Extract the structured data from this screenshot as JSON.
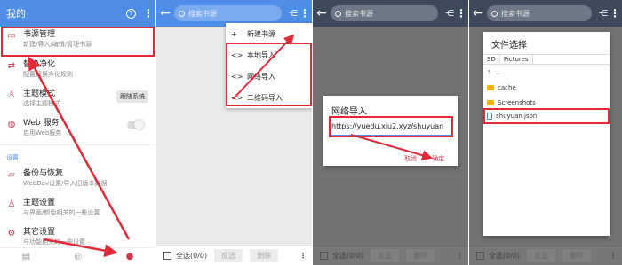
{
  "panel1": {
    "title": "我的",
    "items": [
      {
        "icon": "book-icon",
        "title": "书源管理",
        "subtitle": "新建/导入/编辑/管理书源"
      },
      {
        "icon": "replace-icon",
        "title": "替换净化",
        "subtitle": "配置替换净化规则"
      },
      {
        "icon": "shirt-icon",
        "title": "主题模式",
        "subtitle": "选择主题模式",
        "badge": "跟随系统"
      },
      {
        "icon": "globe-icon",
        "title": "Web 服务",
        "subtitle": "启用Web服务"
      }
    ],
    "section_label": "设置",
    "settings": [
      {
        "icon": "folder-icon",
        "title": "备份与恢复",
        "subtitle": "WebDav设置/导入旧版本数据"
      },
      {
        "icon": "shirt-icon",
        "title": "主题设置",
        "subtitle": "与界面/颜色相关的一些设置"
      },
      {
        "icon": "gear-icon",
        "title": "其它设置",
        "subtitle": "与功能相关的一些设置"
      }
    ]
  },
  "panel2": {
    "search_placeholder": "搜索书源",
    "menu": [
      {
        "icon": "+",
        "label": "新建书源"
      },
      {
        "icon": "<>",
        "label": "本地导入"
      },
      {
        "icon": "<>",
        "label": "网络导入"
      },
      {
        "icon": "<>",
        "label": "二维码导入"
      }
    ]
  },
  "panel3": {
    "search_placeholder": "搜索书源",
    "dialog": {
      "title": "网络导入",
      "input_value": "https://yuedu.xiu2.xyz/shuyuan",
      "cancel": "取消",
      "ok": "确定"
    }
  },
  "panel4": {
    "search_placeholder": "搜索书源",
    "dialog": {
      "title": "文件选择",
      "tabs": [
        "SD",
        "Pictures"
      ],
      "rows": [
        {
          "type": "up",
          "name": ".."
        },
        {
          "type": "folder",
          "name": "cache"
        },
        {
          "type": "folder",
          "name": "Screenshots"
        },
        {
          "type": "file",
          "name": "shuyuan.json"
        }
      ]
    }
  },
  "bottombar": {
    "select_all": "全选(0/0)",
    "invert": "反选",
    "delete": "删除"
  },
  "colors": {
    "appbar": "#4f8ee8",
    "accent_red": "#d3344a",
    "highlight_box": "#e02a3a"
  }
}
